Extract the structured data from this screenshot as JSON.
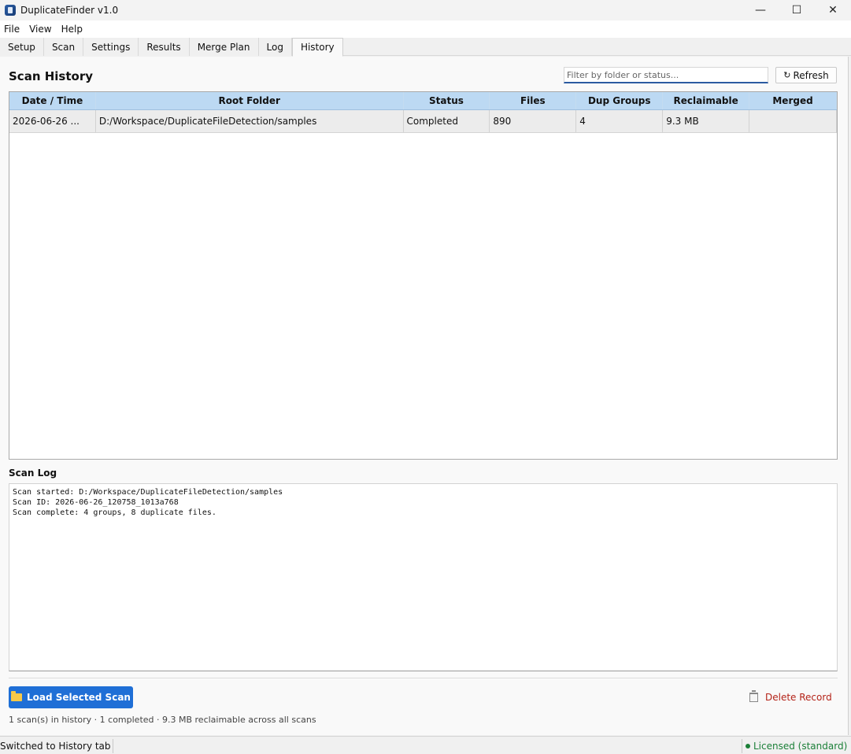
{
  "window": {
    "title": "DuplicateFinder v1.0",
    "minimize": "—",
    "maximize": "☐",
    "close": "✕"
  },
  "menu": [
    "File",
    "View",
    "Help"
  ],
  "tabs": [
    "Setup",
    "Scan",
    "Settings",
    "Results",
    "Merge Plan",
    "Log",
    "History"
  ],
  "active_tab": "History",
  "history": {
    "title": "Scan History",
    "filter_placeholder": "Filter by folder or status...",
    "refresh_label": "Refresh",
    "refresh_icon": "↻",
    "columns": [
      "Date / Time",
      "Root Folder",
      "Status",
      "Files",
      "Dup Groups",
      "Reclaimable",
      "Merged"
    ],
    "rows": [
      [
        "2026-06-26 ...",
        "D:/Workspace/DuplicateFileDetection/samples",
        "Completed",
        "890",
        "4",
        "9.3 MB",
        ""
      ]
    ]
  },
  "scan_log": {
    "label": "Scan Log",
    "lines": [
      "Scan started: D:/Workspace/DuplicateFileDetection/samples",
      "Scan ID: 2026-06-26_120758_1013a768",
      "Scan complete: 4 groups, 8 duplicate files."
    ]
  },
  "actions": {
    "load_label": "Load Selected Scan",
    "delete_label": "Delete Record"
  },
  "summary": "1 scan(s) in history  ·  1 completed  ·  9.3 MB reclaimable across all scans",
  "statusbar": {
    "message": "Switched to History tab",
    "license": "Licensed (standard)"
  },
  "colors": {
    "accent": "#1f6fd6",
    "header_bg": "#bcd9f3",
    "danger": "#b42318",
    "ok": "#1a7f37"
  }
}
